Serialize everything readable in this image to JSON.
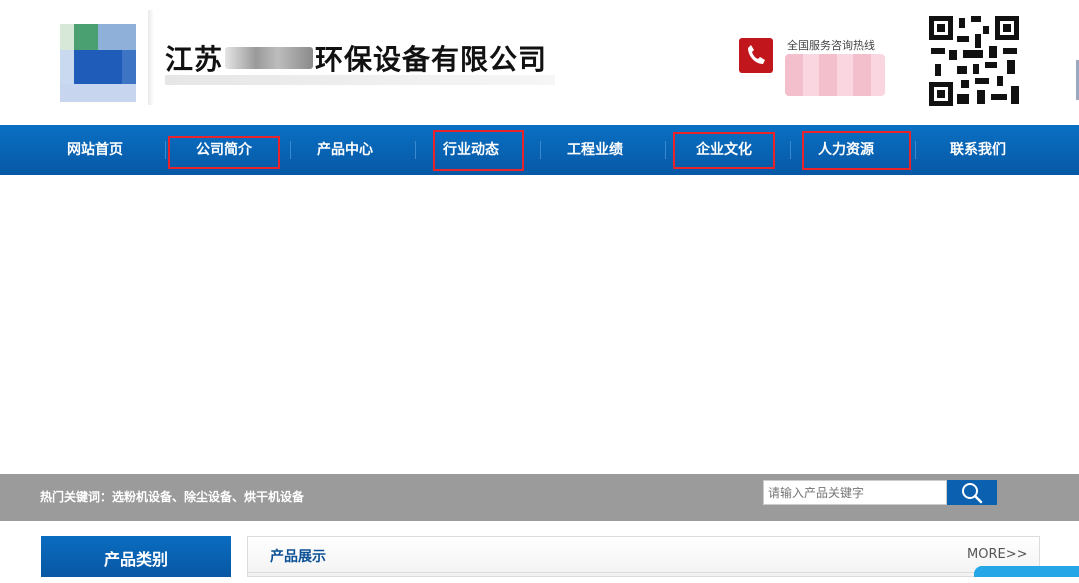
{
  "header": {
    "company_prefix": "江苏",
    "company_suffix": "环保设备有限公司",
    "hotline_label": "全国服务咨询热线"
  },
  "icons": {
    "phone": "phone-icon",
    "search": "search-icon",
    "qrcode": "qrcode-image",
    "logo": "company-logo"
  },
  "colors": {
    "nav_blue": "#0a6dc0",
    "highlight_red": "#e8232a",
    "keyword_bar": "#9b9b9b",
    "phone_red": "#c0161c"
  },
  "nav": {
    "items": [
      {
        "label": "网站首页",
        "highlighted": false
      },
      {
        "label": "公司简介",
        "highlighted": true
      },
      {
        "label": "产品中心",
        "highlighted": false
      },
      {
        "label": "行业动态",
        "highlighted": true
      },
      {
        "label": "工程业绩",
        "highlighted": false
      },
      {
        "label": "企业文化",
        "highlighted": true
      },
      {
        "label": "人力资源",
        "highlighted": true
      },
      {
        "label": "联系我们",
        "highlighted": false
      }
    ]
  },
  "keywords": {
    "label": "热门关键词：",
    "list": "选粉机设备、除尘设备、烘干机设备"
  },
  "search": {
    "placeholder": "请输入产品关键字"
  },
  "sidebar": {
    "title": "产品类别"
  },
  "products": {
    "title": "产品展示",
    "more": "MORE>>"
  }
}
